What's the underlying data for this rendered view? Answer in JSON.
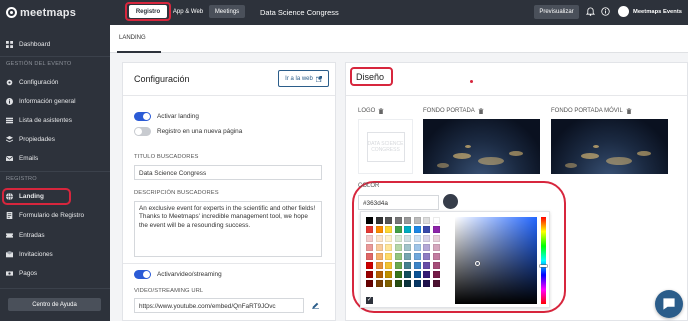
{
  "brand": {
    "name": "meetmaps"
  },
  "sidebar": {
    "items": [
      {
        "label": "Dashboard",
        "icon": "grid-icon"
      },
      {
        "label": "Configuración",
        "icon": "gear-icon"
      },
      {
        "label": "Información general",
        "icon": "info-icon"
      },
      {
        "label": "Lista de asistentes",
        "icon": "list-icon"
      },
      {
        "label": "Propiedades",
        "icon": "stack-icon"
      },
      {
        "label": "Emails",
        "icon": "mail-icon"
      },
      {
        "label": "Landing",
        "icon": "globe-icon",
        "active": true
      },
      {
        "label": "Formulario de Registro",
        "icon": "form-icon"
      },
      {
        "label": "Entradas",
        "icon": "ticket-icon"
      },
      {
        "label": "Invitaciones",
        "icon": "invite-icon"
      },
      {
        "label": "Pagos",
        "icon": "money-icon"
      }
    ],
    "sections": {
      "event": "GESTIÓN DEL EVENTO",
      "registro": "REGISTRO"
    },
    "help_label": "Centro de Ayuda"
  },
  "topbar": {
    "tabs": [
      "Registro",
      "App & Web",
      "Meetings"
    ],
    "event_title": "Data Science Congress",
    "preview_label": "Previsualizar",
    "user_name": "Meetmaps Events"
  },
  "subtabs": {
    "landing": "LANDING"
  },
  "config": {
    "title": "Configuración",
    "web_button": "Ir a la web",
    "toggle_landing": "Activar landing",
    "toggle_new_page": "Registro en una nueva página",
    "seo_title_label": "TITULO BUSCADORES",
    "seo_title_value": "Data Science Congress",
    "seo_desc_label": "DESCRIPCIÓN BUSCADORES",
    "seo_desc_value": "An exclusive event for experts in the scientific and other fields! Thanks to Meetmaps' incredible management tool, we hope the event will be a resounding success.",
    "toggle_video": "Activarvideo/streaming",
    "video_label": "VIDEO/STREAMING URL",
    "video_value": "https://www.youtube.com/embed/QnFaRT9JOvc"
  },
  "design": {
    "title": "Diseño",
    "logo_label": "LOGO",
    "cover_label": "FONDO PORTADA",
    "cover_mobile_label": "FONDO PORTADA MÓVIL",
    "logo_placeholder": "DATA SCIENCE CONGRESS",
    "color_label": "COLOR",
    "color_value": "#363d4a",
    "swatches": [
      "#000000",
      "#333333",
      "#555555",
      "#777777",
      "#999999",
      "#bbbbbb",
      "#dddddd",
      "#ffffff",
      "#e53935",
      "#fb8c00",
      "#fdd835",
      "#43a047",
      "#00acc1",
      "#1e88e5",
      "#3949ab",
      "#8e24aa",
      "#f4cccc",
      "#fce5cd",
      "#fff2cc",
      "#d9ead3",
      "#d0e0e3",
      "#cfe2f3",
      "#d9d2e9",
      "#ead1dc",
      "#ea9999",
      "#f9cb9c",
      "#ffe599",
      "#b6d7a8",
      "#a2c4c9",
      "#9fc5e8",
      "#b4a7d6",
      "#d5a6bd",
      "#e06666",
      "#f6b26b",
      "#ffd966",
      "#93c47d",
      "#76a5af",
      "#6fa8dc",
      "#8e7cc3",
      "#c27ba0",
      "#cc0000",
      "#e69138",
      "#f1c232",
      "#6aa84f",
      "#45818e",
      "#3d85c6",
      "#674ea7",
      "#a64d79",
      "#990000",
      "#b45f06",
      "#bf9000",
      "#38761d",
      "#134f5c",
      "#0b5394",
      "#351c75",
      "#741b47",
      "#660000",
      "#783f04",
      "#7f6000",
      "#274e13",
      "#0c343d",
      "#073763",
      "#20124d",
      "#4c1130"
    ]
  }
}
